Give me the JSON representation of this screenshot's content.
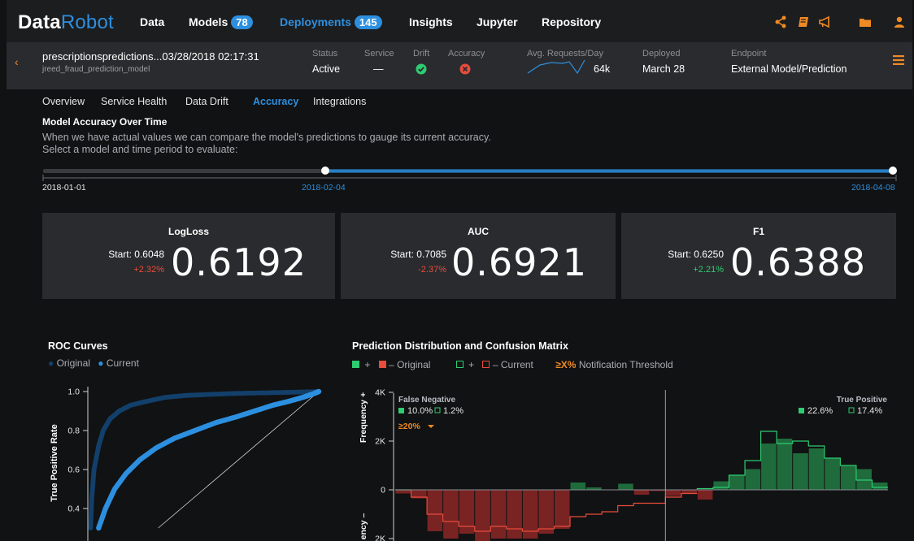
{
  "nav": {
    "logo_primary": "Data",
    "logo_secondary": "Robot",
    "items": [
      {
        "label": "Data"
      },
      {
        "label": "Models",
        "badge": "78"
      },
      {
        "label": "Deployments",
        "badge": "145"
      },
      {
        "label": "Insights"
      },
      {
        "label": "Jupyter"
      },
      {
        "label": "Repository"
      }
    ],
    "icons": [
      "share-icon",
      "book-icon",
      "megaphone-icon",
      "folder-icon",
      "user-icon"
    ]
  },
  "deployment": {
    "title": "prescriptionspredictions...03/28/2018 02:17:31",
    "subtitle": "jreed_fraud_prediction_model",
    "status_label": "Status",
    "status_value": "Active",
    "service_label": "Service",
    "service_value": "—",
    "drift_label": "Drift",
    "accuracy_label": "Accuracy",
    "requests_label": "Avg. Requests/Day",
    "requests_value": "64k",
    "deployed_label": "Deployed",
    "deployed_value": "March 28",
    "endpoint_label": "Endpoint",
    "endpoint_value": "External Model/Prediction"
  },
  "tabs": [
    {
      "label": "Overview"
    },
    {
      "label": "Service Health"
    },
    {
      "label": "Data Drift"
    },
    {
      "label": "Accuracy"
    },
    {
      "label": "Integrations"
    }
  ],
  "accuracy": {
    "title": "Model Accuracy Over Time",
    "desc1": "When we have actual values we can compare the model's predictions to gauge its current accuracy.",
    "desc2": "Select a model and time period to evaluate:",
    "timeline_start": "2018-01-01",
    "timeline_selected": "2018-02-04",
    "timeline_end": "2018-04-08"
  },
  "metrics": [
    {
      "title": "LogLoss",
      "start": "Start: 0.6048",
      "change": "+2.32%",
      "value": "0.6192"
    },
    {
      "title": "AUC",
      "start": "Start: 0.7085",
      "change": "-2.37%",
      "value": "0.6921"
    },
    {
      "title": "F1",
      "start": "Start: 0.6250",
      "change": "+2.21%",
      "value": "0.6388"
    }
  ],
  "roc": {
    "title": "ROC Curves",
    "legend_original": "Original",
    "legend_current": "Current",
    "ylabel": "True Positive Rate",
    "yticks": [
      "1.0",
      "0.8",
      "0.6",
      "0.4"
    ]
  },
  "dist": {
    "title": "Prediction Distribution and Confusion Matrix",
    "legend_original": "Original",
    "legend_current": "Current",
    "threshold_prefix": "≥X%",
    "threshold_label": "Notification Threshold",
    "ylabel_pos": "Frequency +",
    "ylabel_neg": "ency –",
    "yticks": [
      "4K",
      "2K",
      "0",
      "2K"
    ],
    "fn_label": "False Negative",
    "fn_original": "10.0%",
    "fn_current": "1.2%",
    "fn_threshold": "≥20%",
    "tp_label": "True Positive",
    "tp_original": "22.6%",
    "tp_current": "17.4%"
  },
  "chart_data": [
    {
      "type": "scatter",
      "title": "ROC Curves",
      "ylabel": "True Positive Rate",
      "ylim": [
        0.3,
        1.0
      ],
      "series": [
        {
          "name": "Original",
          "x": [
            0.005,
            0.01,
            0.02,
            0.04,
            0.06,
            0.09,
            0.13,
            0.18,
            0.25,
            0.33,
            0.42,
            0.52,
            0.63,
            0.75,
            0.87,
            1.0
          ],
          "y": [
            0.3,
            0.45,
            0.6,
            0.72,
            0.8,
            0.86,
            0.9,
            0.93,
            0.95,
            0.97,
            0.98,
            0.985,
            0.99,
            0.993,
            0.996,
            1.0
          ]
        },
        {
          "name": "Current",
          "x": [
            0.04,
            0.07,
            0.11,
            0.16,
            0.22,
            0.29,
            0.37,
            0.46,
            0.55,
            0.64,
            0.72,
            0.8,
            0.87,
            0.93,
            0.98,
            1.0
          ],
          "y": [
            0.3,
            0.4,
            0.5,
            0.58,
            0.65,
            0.71,
            0.76,
            0.8,
            0.84,
            0.87,
            0.9,
            0.93,
            0.95,
            0.97,
            0.99,
            1.0
          ]
        }
      ]
    },
    {
      "type": "bar",
      "title": "Prediction Distribution and Confusion Matrix",
      "ylabel": "Frequency",
      "ylim": [
        -2400,
        4000
      ],
      "threshold_bin": 17,
      "series": [
        {
          "name": "Original",
          "values": [
            -150,
            -350,
            -1700,
            -2000,
            -1800,
            -2200,
            -2000,
            -2000,
            -2000,
            -1800,
            -1600,
            300,
            100,
            0,
            250,
            -200,
            -50,
            -250,
            -150,
            -400,
            350,
            600,
            850,
            1900,
            2100,
            1500,
            1700,
            1300,
            1000,
            850,
            300
          ]
        },
        {
          "name": "Current",
          "values": [
            0,
            -300,
            -1000,
            -1300,
            -1500,
            -1700,
            -1500,
            -1600,
            -1700,
            -1600,
            -1500,
            -1100,
            -1000,
            -900,
            -650,
            -550,
            -550,
            -300,
            -150,
            50,
            100,
            600,
            1200,
            2400,
            1900,
            2000,
            1800,
            1300,
            1000,
            400,
            100
          ]
        }
      ]
    }
  ]
}
